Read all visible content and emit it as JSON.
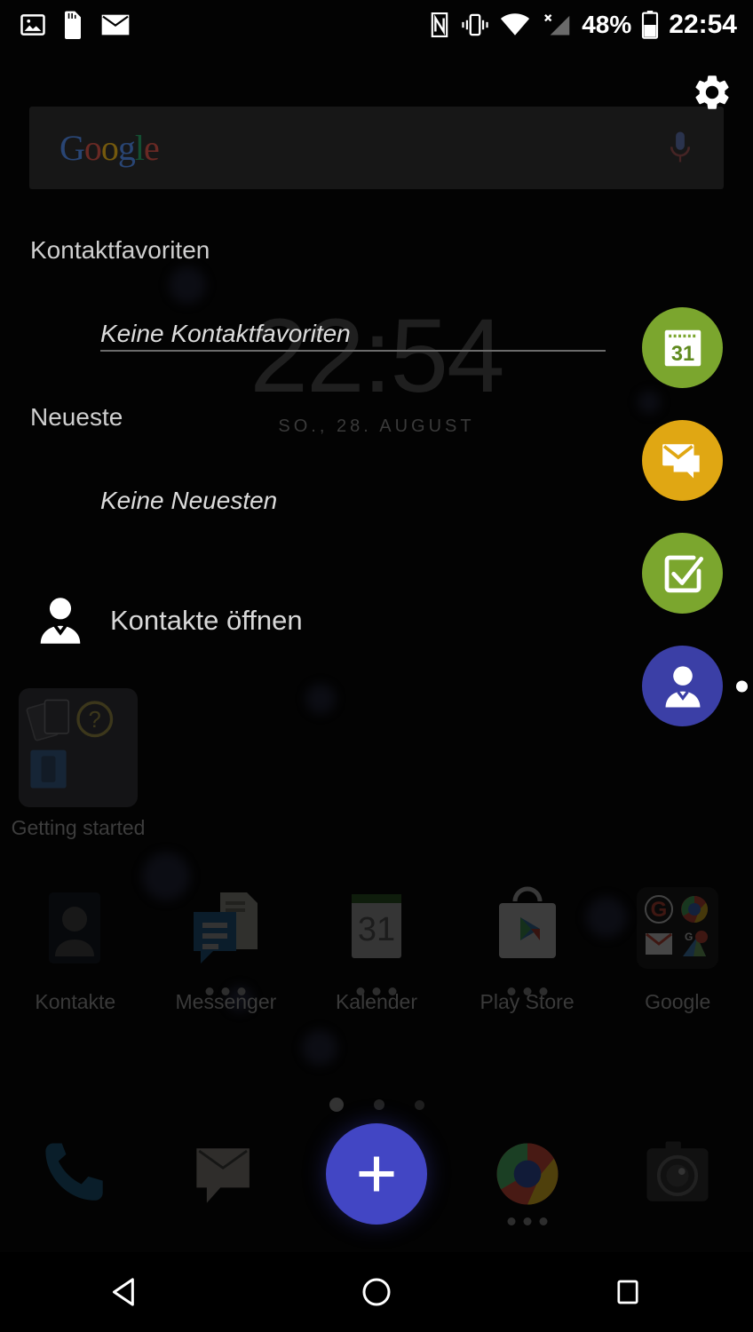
{
  "statusbar": {
    "left_icons": [
      "photo-icon",
      "sd-card-icon",
      "mail-icon"
    ],
    "right_icons": [
      "nfc-icon",
      "vibrate-icon",
      "wifi-icon",
      "no-sim-signal-icon",
      "battery-icon"
    ],
    "battery_percent": "48%",
    "clock": "22:54"
  },
  "search": {
    "logo_letters": [
      "G",
      "o",
      "o",
      "g",
      "l",
      "e"
    ],
    "mic_icon": "microphone-icon"
  },
  "gear": {
    "icon": "gear-icon"
  },
  "clock_widget": {
    "time": "22:54",
    "date": "SO., 28. AUGUST"
  },
  "contacts_overlay": {
    "favorites_header": "Kontaktfavoriten",
    "favorites_empty": "Keine Kontaktfavoriten",
    "recent_header": "Neueste",
    "recent_empty": "Keine Neuesten",
    "open_contacts_label": "Kontakte öffnen",
    "open_contacts_icon": "person-icon"
  },
  "action_rail": {
    "items": [
      {
        "name": "calendar",
        "icon": "calendar-31-icon",
        "color": "#7BA62E",
        "day": "31",
        "selected": false
      },
      {
        "name": "mail",
        "icon": "mail-chat-icon",
        "color": "#E0A713",
        "selected": false
      },
      {
        "name": "tasks",
        "icon": "checkbox-check-icon",
        "color": "#7BA62E",
        "selected": false
      },
      {
        "name": "contacts",
        "icon": "person-icon",
        "color": "#3B3FA6",
        "selected": true
      }
    ]
  },
  "getting_started": {
    "label": "Getting started",
    "icon": "getting-started-folder-icon"
  },
  "app_grid": {
    "apps": [
      {
        "label": "Kontakte",
        "icon": "contacts-app-icon",
        "has_dots": false
      },
      {
        "label": "Messenger",
        "icon": "messenger-app-icon",
        "has_dots": true
      },
      {
        "label": "Kalender",
        "icon": "calendar-app-icon",
        "has_dots": true
      },
      {
        "label": "Play Store",
        "icon": "play-store-app-icon",
        "has_dots": true
      },
      {
        "label": "Google",
        "icon": "google-folder-icon",
        "has_dots": false
      }
    ]
  },
  "page_indicator": {
    "count": 3,
    "active_index": 0
  },
  "dock": {
    "items": [
      {
        "name": "phone",
        "icon": "phone-icon",
        "has_dots": false
      },
      {
        "name": "messaging",
        "icon": "message-icon",
        "has_dots": false
      },
      {
        "name": "add",
        "icon": "plus-icon",
        "has_dots": false
      },
      {
        "name": "chrome",
        "icon": "chrome-icon",
        "has_dots": true
      },
      {
        "name": "camera",
        "icon": "camera-icon",
        "has_dots": false
      }
    ],
    "fab_color": "#4246c4"
  },
  "navbar": {
    "back": "back-triangle-icon",
    "home": "home-circle-icon",
    "recents": "recents-square-icon"
  }
}
